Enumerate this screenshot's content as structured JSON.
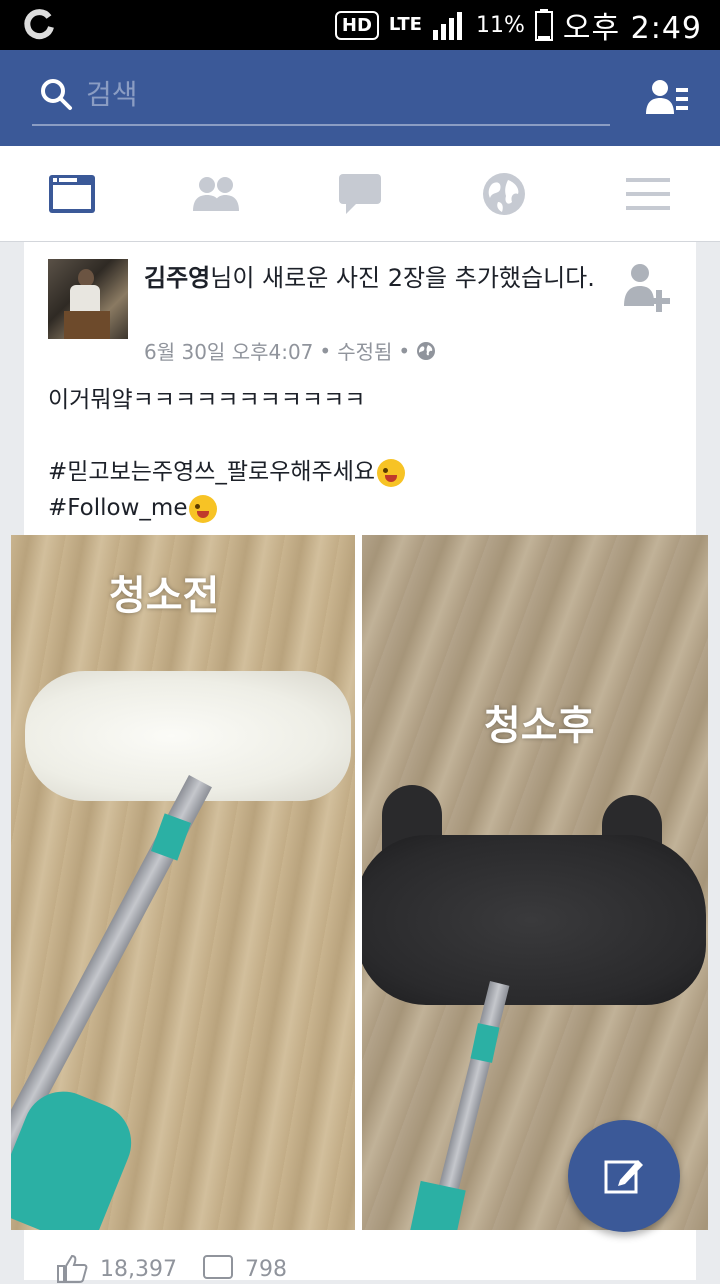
{
  "status_bar": {
    "hd": "HD",
    "network": "LTE",
    "battery": "11%",
    "time": "오후 2:49"
  },
  "search": {
    "placeholder": "검색"
  },
  "tabs": [
    {
      "name": "news-feed",
      "icon": "newsfeed-icon",
      "active": true
    },
    {
      "name": "friends",
      "icon": "friends-icon",
      "active": false
    },
    {
      "name": "messages",
      "icon": "chat-icon",
      "active": false
    },
    {
      "name": "notifications",
      "icon": "globe-icon",
      "active": false
    },
    {
      "name": "more",
      "icon": "menu-icon",
      "active": false
    }
  ],
  "post": {
    "author": "김주영",
    "action": "님이 새로운 사진 2장을 추가했습니다.",
    "date": "6월 30일 오후4:07",
    "edited": "수정됨",
    "text_lines": [
      "이거뭐얔ㅋㅋㅋㅋㅋㅋㅋㅋㅋㅋㅋ",
      "",
      "#믿고보는주영쓰_팔로우해주세요",
      "#Follow_me"
    ],
    "photo_left_label": "청소전",
    "photo_right_label": "청소후",
    "likes": "18,397",
    "comments": "798"
  },
  "colors": {
    "brand": "#3b5998",
    "meta_gray": "#90949c",
    "mop_teal": "#2bb0a4"
  }
}
